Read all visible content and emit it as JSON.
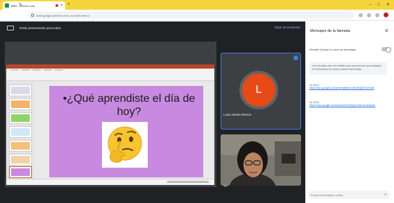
{
  "browser": {
    "tab_title": "Meet - Round Lima",
    "url": "meet.google.com/xxx-xxxx-xxx?authuser=0"
  },
  "meet": {
    "presenting_text": "Estás presentando para todos",
    "stop_presenting": "Dejar de presentar"
  },
  "slide": {
    "title": "•¿Qué aprendiste el día de hoy?"
  },
  "self_tile": {
    "avatar_letter": "L",
    "name": "Luisa Varela Ramos"
  },
  "camera_tile": {
    "name": "Tú"
  },
  "chat": {
    "title": "Mensajes de la llamada",
    "allow_label": "Permitir a todos el envío de mensajes",
    "notice": "Los mensajes solo son visibles para las personas que participan en la llamada y se borran cuando esta finaliza",
    "messages": [
      {
        "head": "Tú  10:12",
        "link": "https://docs.google.com/presentation/d/1bExRQ8nH7xK/edit"
      },
      {
        "head": "Tú  10:13",
        "link": "https://docs.google.com/forms/d/e/1FAIpQLSc9pLm/viewform"
      }
    ],
    "input_placeholder": "Envía un mensaje a todos"
  },
  "colors": {
    "accent": "#3d7fe8",
    "slide_bg": "#c88ae0",
    "ppt_ribbon": "#b7472a",
    "tab_strip": "#f4d63c",
    "avatar": "#e64a19"
  }
}
